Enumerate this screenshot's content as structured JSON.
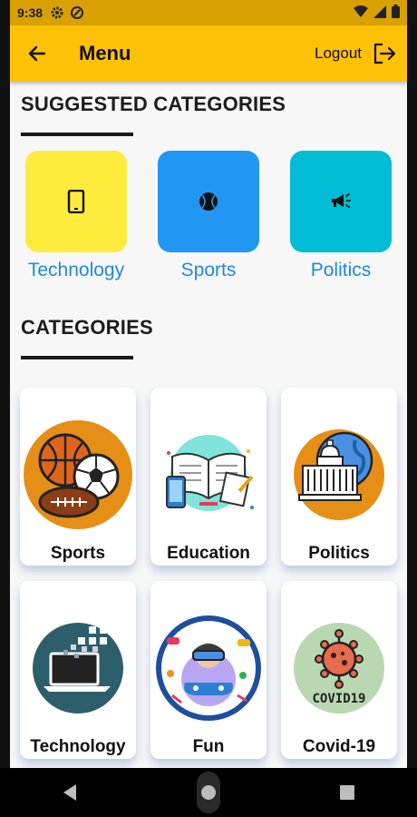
{
  "status_bar": {
    "time": "9:38"
  },
  "appbar": {
    "title": "Menu",
    "logout_label": "Logout"
  },
  "suggested": {
    "heading": "SUGGESTED CATEGORIES",
    "items": [
      {
        "label": "Technology",
        "color": "#ffeb3b",
        "icon": "tablet-icon"
      },
      {
        "label": "Sports",
        "color": "#2196f3",
        "icon": "ball-icon"
      },
      {
        "label": "Politics",
        "color": "#00bcd4",
        "icon": "megaphone-icon"
      }
    ]
  },
  "categories": {
    "heading": "CATEGORIES",
    "items": [
      {
        "label": "Sports",
        "icon": "sports-balls-icon",
        "color": "#e58f17"
      },
      {
        "label": "Education",
        "icon": "education-icon",
        "color": "#7fe4dc"
      },
      {
        "label": "Politics",
        "icon": "capitol-globe-icon",
        "color": "#e58f17"
      },
      {
        "label": "Technology",
        "icon": "laptop-icon",
        "color": "#2d5e6b"
      },
      {
        "label": "Fun",
        "icon": "vr-gaming-icon",
        "color": "#1d4f9e"
      },
      {
        "label": "Covid-19",
        "icon": "virus-icon",
        "color": "#b9d8b2"
      }
    ],
    "covid_badge": "COVID19"
  },
  "colors": {
    "accent": "#ffc107",
    "status_bar": "#d9a100",
    "link_blue": "#1e88e5"
  }
}
